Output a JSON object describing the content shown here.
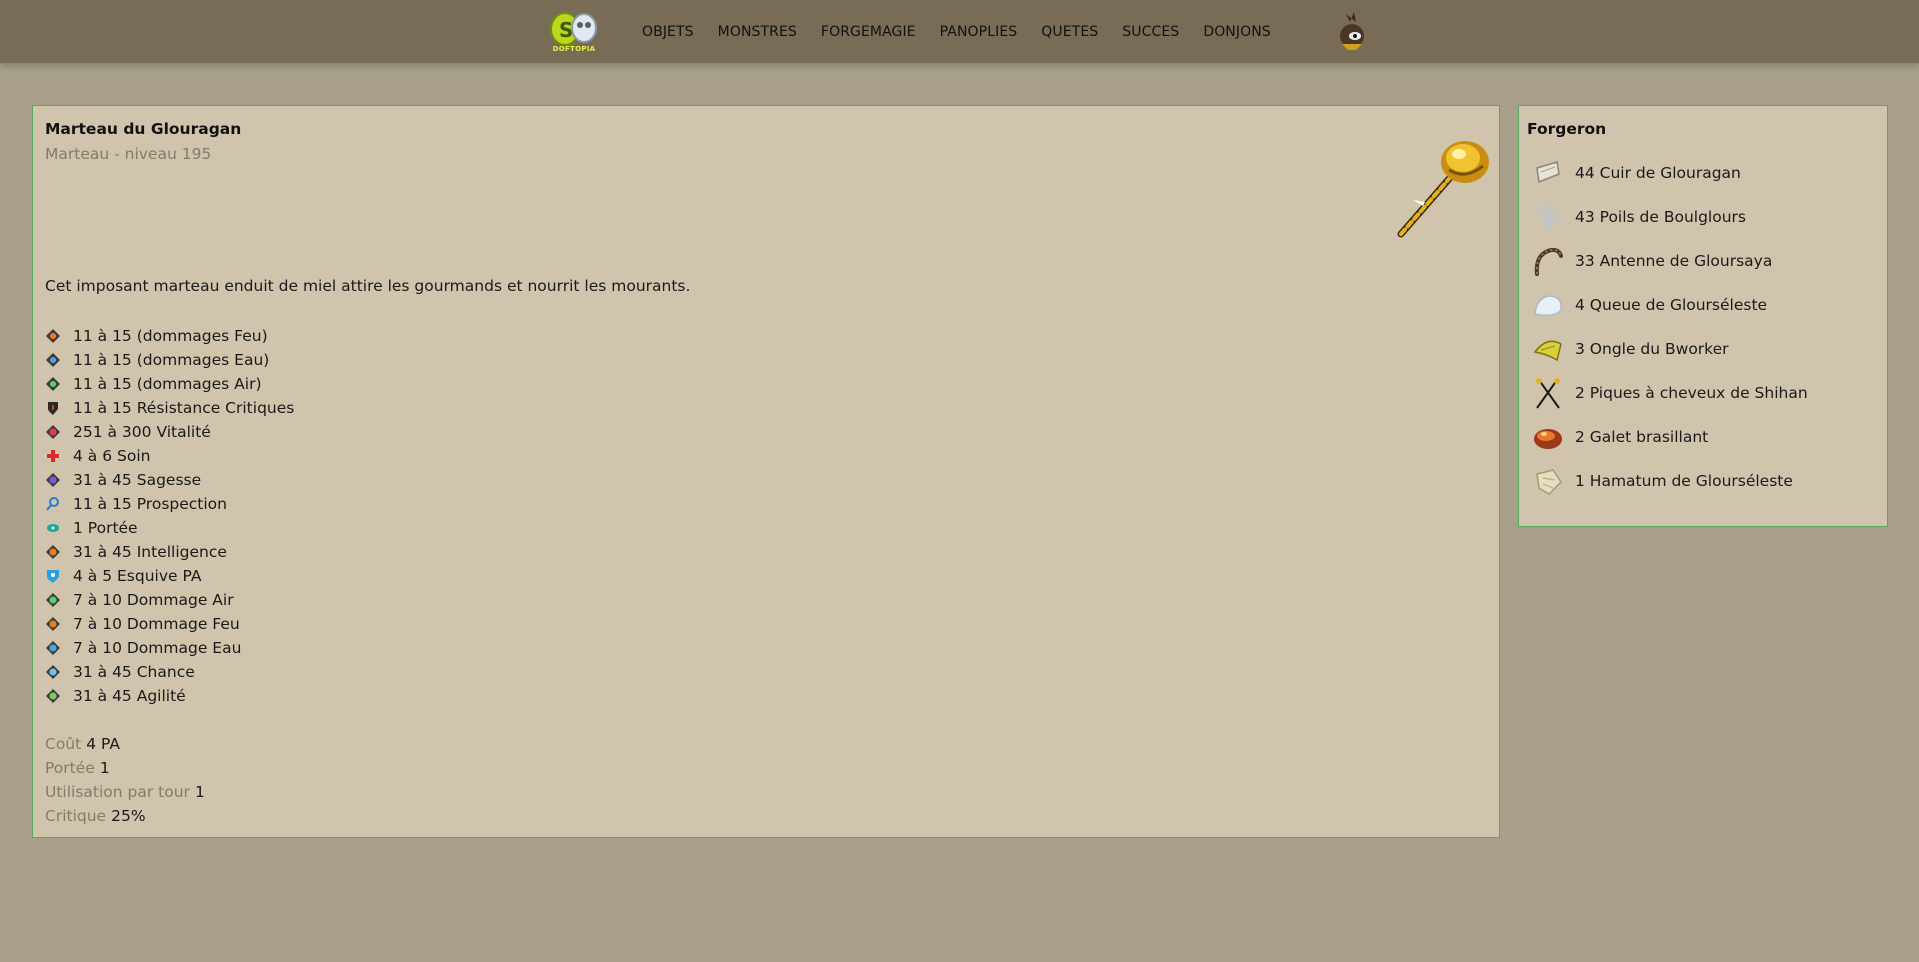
{
  "nav": {
    "logo_text": "DOFTOPIA",
    "items": [
      "OBJETS",
      "MONSTRES",
      "FORGEMAGIE",
      "PANOPLIES",
      "QUETES",
      "SUCCES",
      "DONJONS"
    ]
  },
  "item": {
    "name": "Marteau du Glouragan",
    "subtitle": "Marteau - niveau 195",
    "description": "Cet imposant marteau enduit de miel attire les gourmands et nourrit les mourants.",
    "stats": [
      {
        "text": "11 à 15 (dommages Feu)",
        "icon": "fire-damage-icon"
      },
      {
        "text": "11 à 15 (dommages Eau)",
        "icon": "water-damage-icon"
      },
      {
        "text": "11 à 15 (dommages Air)",
        "icon": "air-damage-icon"
      },
      {
        "text": "11 à 15 Résistance Critiques",
        "icon": "critical-resistance-icon"
      },
      {
        "text": "251 à 300 Vitalité",
        "icon": "vitality-icon"
      },
      {
        "text": "4 à 6 Soin",
        "icon": "heal-icon"
      },
      {
        "text": "31 à 45 Sagesse",
        "icon": "wisdom-icon"
      },
      {
        "text": "11 à 15 Prospection",
        "icon": "prospecting-icon"
      },
      {
        "text": "1 Portée",
        "icon": "range-icon"
      },
      {
        "text": "31 à 45 Intelligence",
        "icon": "intelligence-icon"
      },
      {
        "text": "4 à 5 Esquive PA",
        "icon": "ap-dodge-icon"
      },
      {
        "text": "7 à 10 Dommage Air",
        "icon": "air-damage-icon"
      },
      {
        "text": "7 à 10 Dommage Feu",
        "icon": "fire-damage-icon"
      },
      {
        "text": "7 à 10 Dommage Eau",
        "icon": "water-damage-icon"
      },
      {
        "text": "31 à 45 Chance",
        "icon": "chance-icon"
      },
      {
        "text": "31 à 45 Agilité",
        "icon": "agility-icon"
      }
    ],
    "properties": [
      {
        "label": "Coût",
        "value": "4 PA"
      },
      {
        "label": "Portée",
        "value": "1"
      },
      {
        "label": "Utilisation par tour",
        "value": "1"
      },
      {
        "label": "Critique",
        "value": "25%"
      }
    ]
  },
  "recipe": {
    "title": "Forgeron",
    "ingredients": [
      {
        "text": "44 Cuir de Glouragan",
        "icon": "leather-icon"
      },
      {
        "text": "43 Poils de Boulglours",
        "icon": "hair-icon"
      },
      {
        "text": "33 Antenne de Gloursaya",
        "icon": "antenna-icon"
      },
      {
        "text": "4 Queue de Glourséleste",
        "icon": "tail-icon"
      },
      {
        "text": "3 Ongle du Bworker",
        "icon": "nail-icon"
      },
      {
        "text": "2 Piques à cheveux de Shihan",
        "icon": "hairpins-icon"
      },
      {
        "text": "2 Galet brasillant",
        "icon": "pebble-icon"
      },
      {
        "text": "1 Hamatum de Glourséleste",
        "icon": "hamatum-icon"
      }
    ]
  },
  "colors": {
    "header_bg": "#786c57",
    "page_bg": "#a8a08b",
    "panel_bg": "#d0c4ad",
    "panel_border": "#4cae5a",
    "muted_text": "#857a6a"
  }
}
